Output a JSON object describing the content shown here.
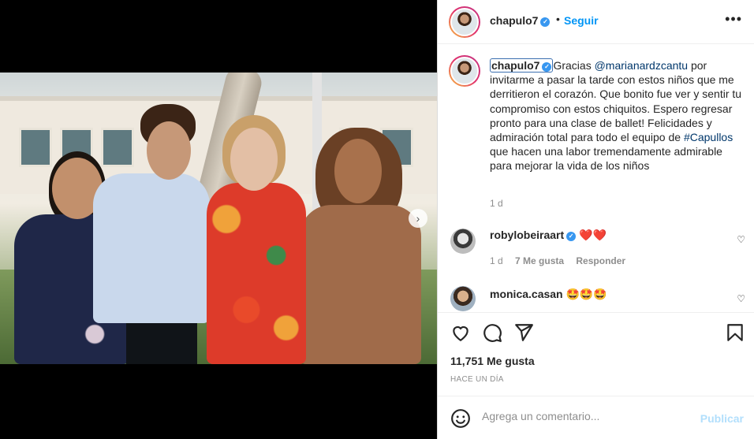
{
  "header": {
    "username": "chapulo7",
    "separator": "•",
    "follow_label": "Seguir",
    "more_label": "•••"
  },
  "caption": {
    "username": "chapulo7",
    "text_before": "Gracias ",
    "mention": "@marianardzcantu",
    "text_middle": " por invitarme a pasar la tarde con estos niños que me derritieron el corazón. Que bonito fue ver y sentir tu compromiso con estos chiquitos. Espero regresar pronto para una clase de ballet! Felicidades y admiración total para todo el equipo de ",
    "hashtag": "#Capullos",
    "text_after": " que hacen una labor tremendamente admirable para mejorar la vida de los niños",
    "time": "1 d"
  },
  "comments": [
    {
      "username": "robylobeiraart",
      "verified": true,
      "text": "❤️❤️",
      "time": "1 d",
      "likes": "7 Me gusta",
      "reply_label": "Responder"
    },
    {
      "username": "monica.casan",
      "verified": false,
      "text": "🤩🤩🤩"
    }
  ],
  "media": {
    "next_arrow": "›",
    "carousel_dots": 2,
    "active_dot": 1
  },
  "actions": {
    "icons": [
      "heart-icon",
      "comment-icon",
      "share-icon",
      "bookmark-icon"
    ]
  },
  "likes_count": "11,751 Me gusta",
  "posted_ago": "HACE UN DÍA",
  "add_comment": {
    "placeholder": "Agrega un comentario...",
    "publish_label": "Publicar"
  },
  "colors": {
    "link_blue": "#0095f6",
    "publish_disabled": "#b2dffc",
    "mention": "#00376b",
    "muted": "#8e8e8e",
    "verified": "#3897f0"
  }
}
